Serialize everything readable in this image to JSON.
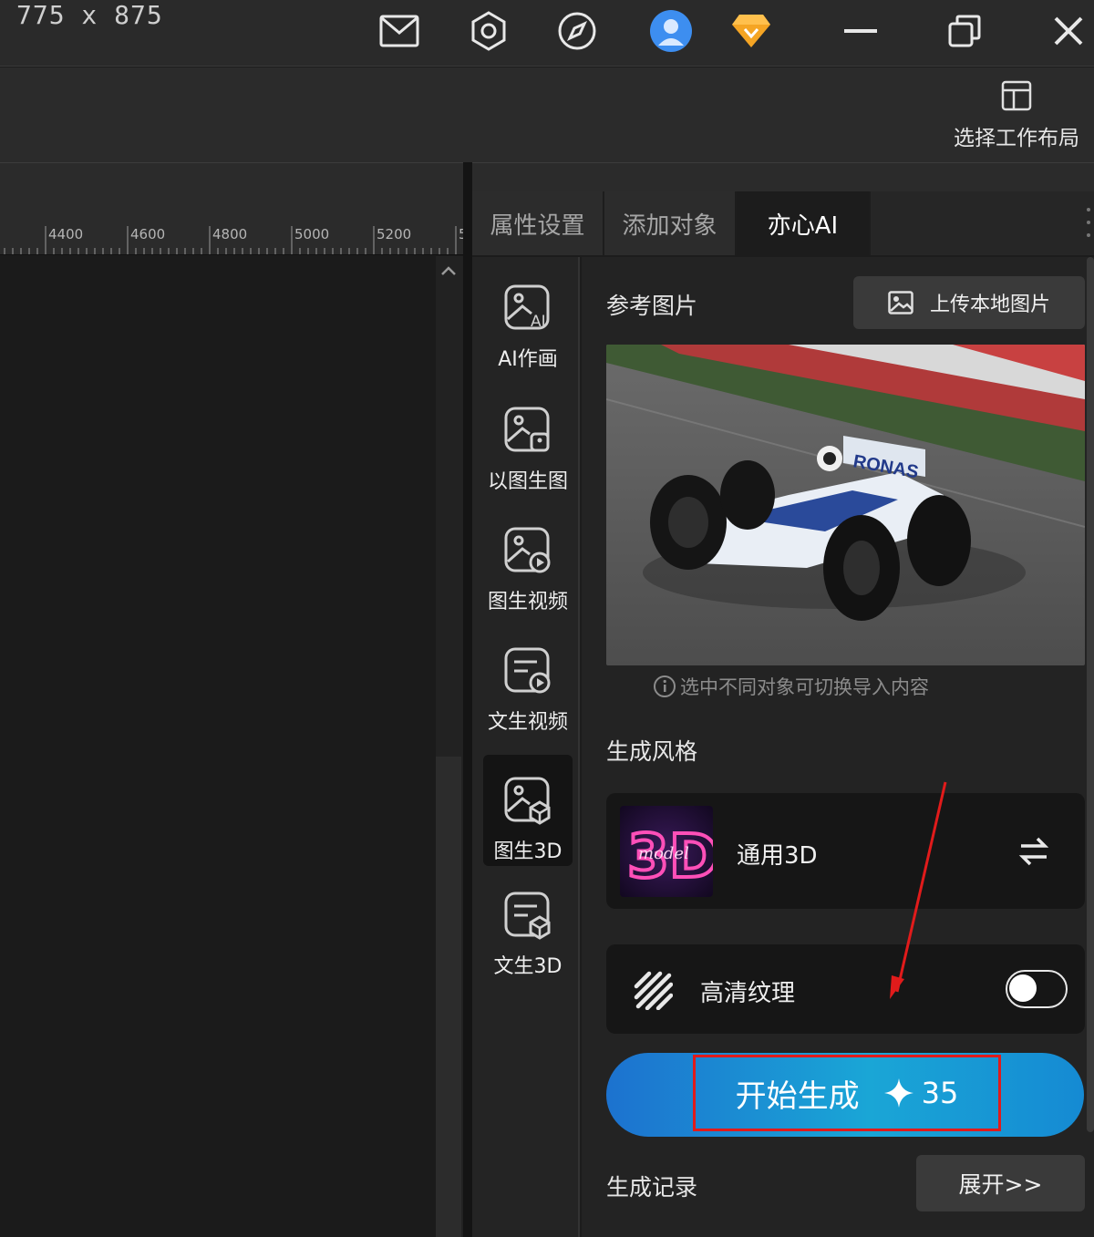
{
  "window": {
    "dimensions_text": "775 x 875"
  },
  "toolbar": {
    "layout_label": "选择工作布局"
  },
  "ruler": {
    "ticks": [
      "4400",
      "4600",
      "4800",
      "5000",
      "5200",
      "5"
    ]
  },
  "tabs": [
    {
      "label": "属性设置",
      "active": false
    },
    {
      "label": "添加对象",
      "active": false
    },
    {
      "label": "亦心AI",
      "active": true
    }
  ],
  "sidebar": {
    "items": [
      {
        "label": "AI作画",
        "icon": "ai-image-icon",
        "active": false
      },
      {
        "label": "以图生图",
        "icon": "image-to-image-icon",
        "active": false
      },
      {
        "label": "图生视频",
        "icon": "image-to-video-icon",
        "active": false
      },
      {
        "label": "文生视频",
        "icon": "text-to-video-icon",
        "active": false
      },
      {
        "label": "图生3D",
        "icon": "image-to-3d-icon",
        "active": true
      },
      {
        "label": "文生3D",
        "icon": "text-to-3d-icon",
        "active": false
      }
    ]
  },
  "reference": {
    "title": "参考图片",
    "upload_label": "上传本地图片",
    "hint": "选中不同对象可切换导入内容"
  },
  "style": {
    "title": "生成风格",
    "name": "通用3D",
    "thumb_text": "3D",
    "thumb_subtext": "model"
  },
  "hd_texture": {
    "label": "高清纹理",
    "enabled": false
  },
  "generate": {
    "label": "开始生成",
    "cost": "35"
  },
  "history": {
    "title": "生成记录",
    "expand_label": "展开>>"
  },
  "colors": {
    "accent_start": "#1c72cf",
    "accent_end": "#1aa6d6",
    "highlight_red": "#e11b1b"
  }
}
